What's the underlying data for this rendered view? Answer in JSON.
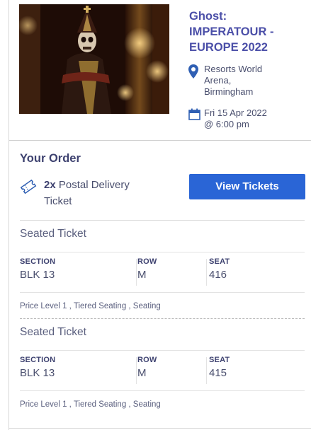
{
  "event": {
    "title_lines": [
      "Ghost:",
      "IMPERATOUR -",
      "EUROPE 2022"
    ],
    "venue_lines": [
      "Resorts World",
      "Arena,",
      "Birmingham"
    ],
    "date_lines": [
      "Fri 15 Apr 2022",
      "@ 6:00 pm"
    ],
    "accent_color": "#4b4fa8"
  },
  "order": {
    "title": "Your Order",
    "quantity": "2x",
    "delivery_line1": "Postal Delivery",
    "delivery_line2": "Ticket",
    "view_button": "View Tickets",
    "button_color": "#2a65d6"
  },
  "tickets": [
    {
      "type": "Seated Ticket",
      "section_label": "SECTION",
      "section": "BLK 13",
      "row_label": "ROW",
      "row": "M",
      "seat_label": "SEAT",
      "seat": "416",
      "price_level": "Price Level 1 , Tiered Seating , Seating"
    },
    {
      "type": "Seated Ticket",
      "section_label": "SECTION",
      "section": "BLK 13",
      "row_label": "ROW",
      "row": "M",
      "seat_label": "SEAT",
      "seat": "415",
      "price_level": "Price Level 1 , Tiered Seating , Seating"
    }
  ],
  "icons": {
    "venue": "map-pin-icon",
    "date": "calendar-icon",
    "ticket": "ticket-icon"
  }
}
